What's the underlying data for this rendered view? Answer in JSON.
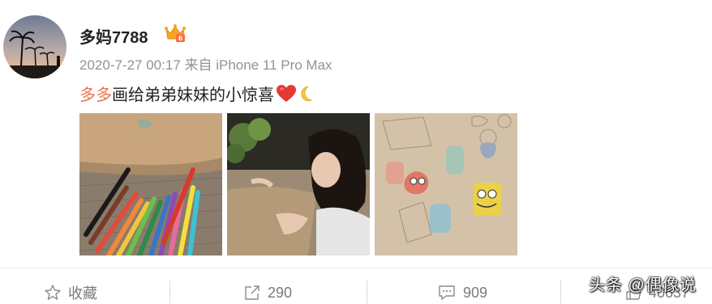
{
  "post": {
    "username": "多妈7788",
    "meta": "2020-7-27 00:17 来自 iPhone 11 Pro Max",
    "mention": "多多",
    "text": "画给弟弟妹妹的小惊喜",
    "badge_icon": "vip-crown-icon"
  },
  "actions": {
    "favorite_label": "收藏",
    "repost_count": "290",
    "comment_count": "909",
    "like_count": "40637"
  },
  "watermark": "头条 @偶像说",
  "colors": {
    "mention": "#eb7350",
    "heart": "#e53935",
    "badge": "#f5a623"
  }
}
